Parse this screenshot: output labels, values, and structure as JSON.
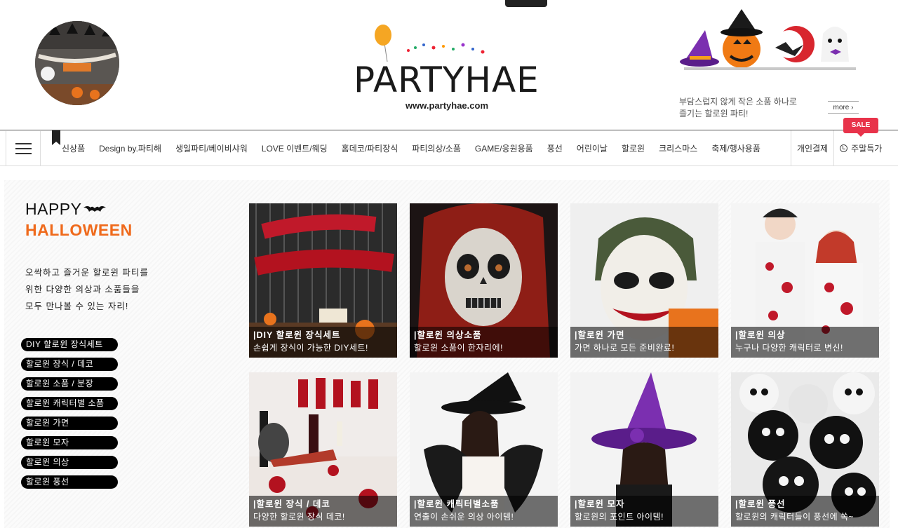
{
  "header": {
    "top_tab": "TOGGLE",
    "logo_text": "PARTYHAE",
    "logo_url": "www.partyhae.com",
    "promo_line1": "부담스럽지 않게 작은 소품 하나로",
    "promo_line2": "즐기는 할로윈 파티!",
    "more_label": "more ›"
  },
  "nav": {
    "items": [
      "신상품",
      "Design by.파티해",
      "생일파티/베이비샤워",
      "LOVE 이벤트/웨딩",
      "홈데코/파티장식",
      "파티의상/소품",
      "GAME/응원용품",
      "풍선",
      "어린이날",
      "할로윈",
      "크리스마스",
      "축제/행사용품"
    ],
    "right_items": [
      "개인결제",
      "주말특가"
    ],
    "sale_badge": "SALE"
  },
  "sidebar": {
    "title_line1": "HAPPY",
    "title_line2": "HALLOWEEN",
    "desc_line1": "오싹하고 즐거운 할로윈 파티를",
    "desc_line2": "위한 다양한 의상과 소품들을",
    "desc_line3": "모두 만나볼 수 있는 자리!",
    "categories": [
      "DIY 할로윈 장식세트",
      "할로윈 장식 / 데코",
      "할로윈 소품 / 분장",
      "할로윈 캐릭터별 소품",
      "할로윈 가면",
      "할로윈 모자",
      "할로윈 의상",
      "할로윈 풍선"
    ]
  },
  "products": [
    {
      "title": "|DIY 할로윈 장식세트",
      "subtitle": "손쉽게 장식이 가능한 DIY세트!"
    },
    {
      "title": "|할로윈 의상소품",
      "subtitle": "할로윈 소품이 한자리에!"
    },
    {
      "title": "|할로윈 가면",
      "subtitle": "가면 하나로 모든 준비완료!"
    },
    {
      "title": "|할로윈 의상",
      "subtitle": "누구나 다양한 캐릭터로 변신!"
    },
    {
      "title": "|할로윈 장식 / 데코",
      "subtitle": "다양한 할로윈 장식 데코!"
    },
    {
      "title": "|할로윈 캐릭터별소품",
      "subtitle": "연출이 손쉬운 의상 아이템!"
    },
    {
      "title": "|할로윈 모자",
      "subtitle": "할로윈의 포인트 아이템!"
    },
    {
      "title": "|할로윈 풍선",
      "subtitle": "할로윈의 캐릭터들이 풍선에 쏙~"
    }
  ],
  "colors": {
    "accent_orange": "#ef6a1c",
    "sale_red": "#e8334a",
    "pill_black": "#000000"
  }
}
